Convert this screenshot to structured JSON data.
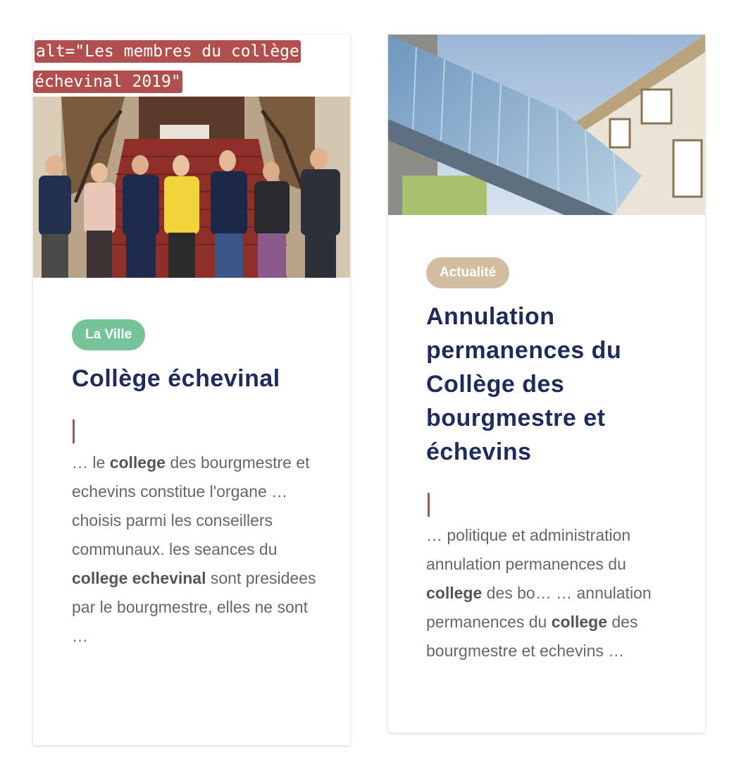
{
  "cards": [
    {
      "image_alt_line1": "alt=\"Les membres du collège",
      "image_alt_line2": "échevinal 2019\"",
      "category": "La Ville",
      "title": "Collège échevinal",
      "excerpt": [
        {
          "text": "… le ",
          "bold": false
        },
        {
          "text": "college",
          "bold": true
        },
        {
          "text": " des bourgmestre et echevins constitue l'organe … choisis parmi les conseillers communaux. les seances du ",
          "bold": false
        },
        {
          "text": "college echevinal",
          "bold": true
        },
        {
          "text": " sont presidees par le bourgmestre, elles ne sont …",
          "bold": false
        }
      ]
    },
    {
      "category": "Actualité",
      "title": "Annulation permanences du Collège des bourgmestre et échevins",
      "excerpt": [
        {
          "text": "… politique et administration annulation permanences du ",
          "bold": false
        },
        {
          "text": "college",
          "bold": true
        },
        {
          "text": " des bo… … annulation permanences du ",
          "bold": false
        },
        {
          "text": "college",
          "bold": true
        },
        {
          "text": " des bourgmestre et echevins …",
          "bold": false
        }
      ]
    }
  ],
  "colors": {
    "title": "#1f2c5b",
    "category_la_ville": "#76c39a",
    "category_actualite": "#d2bda1",
    "accent": "#b04f4d",
    "excerpt_text": "#666666"
  }
}
